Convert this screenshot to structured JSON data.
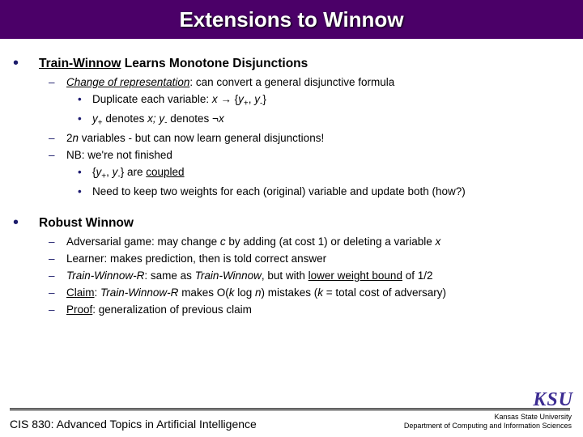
{
  "title": "Extensions to Winnow",
  "section1": {
    "heading_u": "Train-Winnow",
    "heading_rest": " Learns Monotone Disjunctions",
    "a_u": "Change of representation",
    "a_rest": ": can convert a general disjunctive formula",
    "a1_pre": "Duplicate each variable: ",
    "a1_x": "x ",
    "a1_arrow": "→",
    "a1_rest_a": " {",
    "a1_yplusa": "y",
    "a1_yplusb": "+",
    "a1_comma": ", ",
    "a1_yminusa": "y",
    "a1_yminusb": "-",
    "a1_end": "}",
    "a2_pre": "y",
    "a2_sp": "+",
    "a2_txt1": " denotes ",
    "a2_x": "x; ",
    "a2_y2": "y",
    "a2_sm": "-",
    "a2_txt2": " denotes ",
    "a2_neg": "¬",
    "a2_x2": "x",
    "b_pre": "2",
    "b_n": "n",
    "b_rest": " variables - but can now learn general disjunctions!",
    "c": "NB: we're not finished",
    "c1_a": "{",
    "c1_yp": "y",
    "c1_ypp": "+",
    "c1_com": ", ",
    "c1_ym": "y",
    "c1_ymm": "-",
    "c1_b": "} are ",
    "c1_u": "coupled",
    "c2": "Need to keep two weights for each (original) variable and update both (how?)"
  },
  "section2": {
    "heading": "Robust Winnow",
    "a_pre": "Adversarial game: may change ",
    "a_c": "c",
    "a_mid": " by adding (at cost 1) or deleting a variable ",
    "a_x": "x",
    "b": "Learner: makes prediction, then is told correct answer",
    "c_pre": "Train-Winnow-R",
    "c_mid1": ": same as ",
    "c_tw": "Train-Winnow",
    "c_mid2": ", but with ",
    "c_u": "lower weight bound",
    "c_rest": " of 1/2",
    "d_u": "Claim",
    "d_mid1": ": ",
    "d_twr": "Train-Winnow-R",
    "d_mid2": " makes ",
    "d_o": "O",
    "d_mid3": "(",
    "d_k": "k",
    "d_log": " log ",
    "d_n": "n",
    "d_mid4": ") mistakes (",
    "d_k2": "k",
    "d_rest": " = total cost of adversary)",
    "e_u": "Proof",
    "e_rest": ": generalization of previous claim"
  },
  "footer": {
    "left": "CIS 830: Advanced Topics in Artificial Intelligence",
    "logo": "KSU",
    "r1": "Kansas State University",
    "r2": "Department of Computing and Information Sciences"
  }
}
